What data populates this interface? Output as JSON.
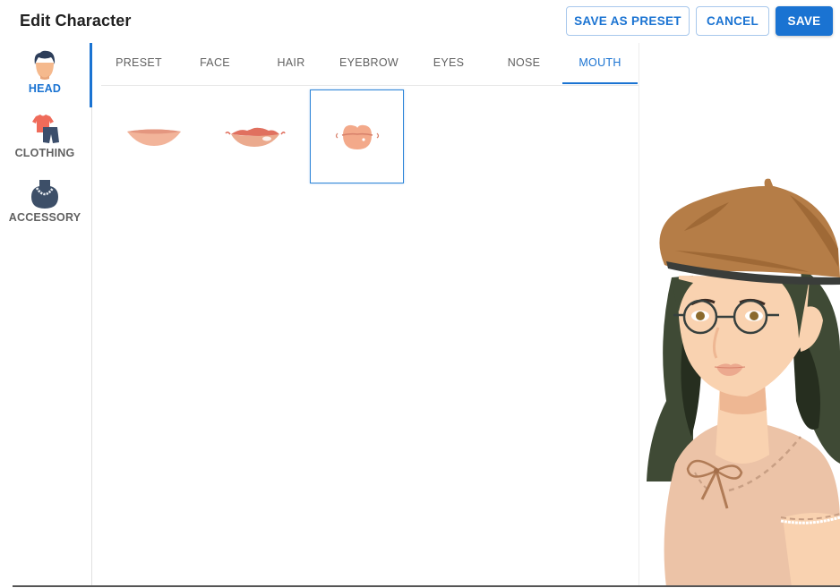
{
  "header": {
    "title": "Edit Character",
    "buttons": {
      "save_as_preset": "SAVE AS PRESET",
      "cancel": "CANCEL",
      "save": "SAVE"
    }
  },
  "colors": {
    "accent": "#1a73d2",
    "hair": "#3f4a35",
    "beret": "#b57d47",
    "skin": "#f9d2b0",
    "shirt": "#ecc3a7"
  },
  "sidebar": {
    "items": [
      {
        "label": "HEAD",
        "icon": "head-icon",
        "active": true
      },
      {
        "label": "CLOTHING",
        "icon": "clothing-icon",
        "active": false
      },
      {
        "label": "ACCESSORY",
        "icon": "necklace-icon",
        "active": false
      }
    ]
  },
  "tabs": [
    {
      "label": "PRESET",
      "active": false
    },
    {
      "label": "FACE",
      "active": false
    },
    {
      "label": "HAIR",
      "active": false
    },
    {
      "label": "EYEBROW",
      "active": false
    },
    {
      "label": "EYES",
      "active": false
    },
    {
      "label": "NOSE",
      "active": false
    },
    {
      "label": "MOUTH",
      "active": true
    }
  ],
  "mouth_options": [
    {
      "name": "mouth-option-1",
      "selected": false
    },
    {
      "name": "mouth-option-2",
      "selected": false
    },
    {
      "name": "mouth-option-3",
      "selected": true
    }
  ]
}
